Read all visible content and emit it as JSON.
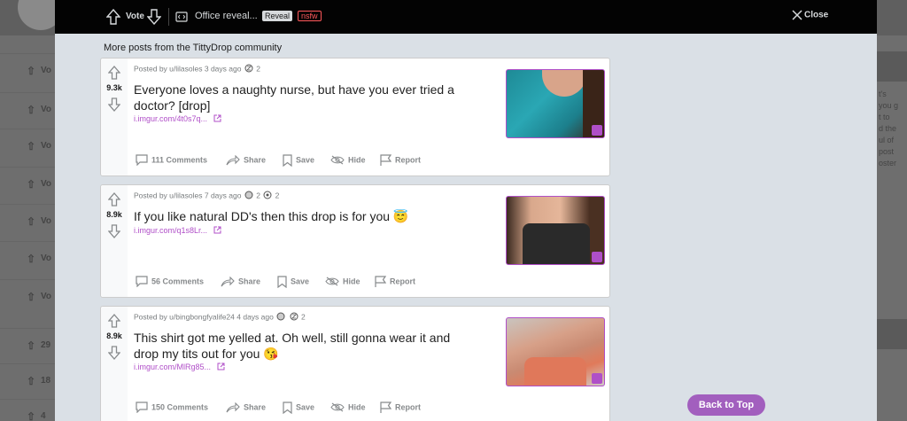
{
  "topbar": {
    "vote_label": "Vote",
    "post_title": "Office reveal...",
    "reveal_label": "Reveal",
    "nsfw_label": "nsfw",
    "close_label": "Close"
  },
  "section_heading": "More posts from the TittyDrop community",
  "posts": [
    {
      "score": "9.3k",
      "meta_posted": "Posted by u/lilasoles 3 days ago",
      "award_count": "2",
      "title": "Everyone loves a naughty nurse, but have you ever tried a doctor? [drop]",
      "link": "i.imgur.com/4t0s7q...",
      "comments": "111 Comments",
      "share": "Share",
      "save": "Save",
      "hide": "Hide",
      "report": "Report"
    },
    {
      "score": "8.9k",
      "meta_posted": "Posted by u/lilasoles 7 days ago",
      "award_count_a": "2",
      "award_count_b": "2",
      "title": "If you like natural DD's then this drop is for you 😇",
      "link": "i.imgur.com/q1s8Lr...",
      "comments": "56 Comments",
      "share": "Share",
      "save": "Save",
      "hide": "Hide",
      "report": "Report"
    },
    {
      "score": "8.9k",
      "meta_posted": "Posted by u/bingbongfyalife24 4 days ago",
      "award_count": "2",
      "title": "This shirt got me yelled at. Oh well, still gonna wear it and drop my tits out for you 😘",
      "link": "i.imgur.com/MlRg85...",
      "comments": "150 Comments",
      "share": "Share",
      "save": "Save",
      "hide": "Hide",
      "report": "Report"
    }
  ],
  "back_to_top": "Back to Top",
  "background": {
    "left_rows": [
      "Vo",
      "Vo",
      "Vo",
      "Vo",
      "Vo",
      "Vo",
      "29",
      "18",
      "4"
    ],
    "right_text": [
      "t's",
      "you g",
      "t to",
      "d the",
      "ul of",
      "post",
      "oster"
    ]
  },
  "colors": {
    "accent": "#b04fc8",
    "button": "#a25fbe",
    "nsfw": "#ff585b",
    "overlay_bg": "#dae0e6",
    "topbar": "#030303"
  },
  "icons": [
    "upvote-icon",
    "downvote-icon",
    "post-icon",
    "close-icon",
    "comment-icon",
    "share-icon",
    "save-icon",
    "hide-icon",
    "report-icon",
    "external-link-icon",
    "award-icon"
  ]
}
